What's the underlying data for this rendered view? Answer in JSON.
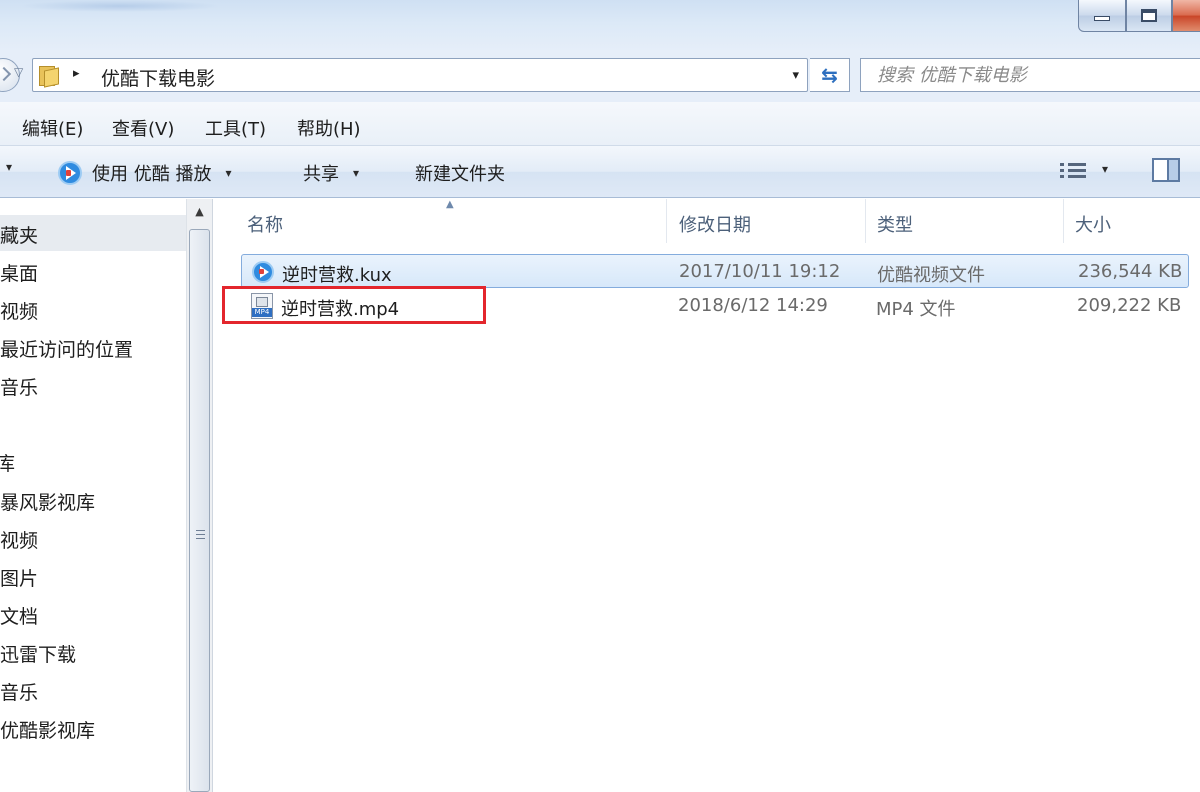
{
  "window": {
    "controls": [
      "minimize",
      "maximize",
      "close"
    ]
  },
  "address": {
    "path": "优酷下载电影",
    "separator": "▸",
    "dropdown": "▾",
    "refresh_icon": "refresh-icon"
  },
  "search": {
    "placeholder": "搜索 优酷下载电影"
  },
  "menubar": {
    "items": [
      "编辑(E)",
      "查看(V)",
      "工具(T)",
      "帮助(H)"
    ]
  },
  "toolbar": {
    "play_label": "使用 优酷 播放",
    "share_label": "共享",
    "new_folder_label": "新建文件夹",
    "caret": "▾"
  },
  "navpane": {
    "items": [
      {
        "label": "收藏夹",
        "visible_text": "藏夹"
      },
      {
        "label": "桌面"
      },
      {
        "label": "视频"
      },
      {
        "label": "最近访问的位置"
      },
      {
        "label": "音乐"
      },
      {
        "label": "库",
        "visible_text": "库"
      },
      {
        "label": "暴风影视库"
      },
      {
        "label": "视频"
      },
      {
        "label": "图片"
      },
      {
        "label": "文档"
      },
      {
        "label": "迅雷下载"
      },
      {
        "label": "音乐"
      },
      {
        "label": "优酷影视库"
      }
    ]
  },
  "filelist": {
    "columns": [
      "名称",
      "修改日期",
      "类型",
      "大小"
    ],
    "rows": [
      {
        "name": "逆时营救.kux",
        "modified": "2017/10/11 19:12",
        "type": "优酷视频文件",
        "size": "236,544 KB",
        "icon": "youku-file-icon",
        "selected": true
      },
      {
        "name": "逆时营救.mp4",
        "modified": "2018/6/12 14:29",
        "type": "MP4 文件",
        "size": "209,222 KB",
        "icon": "mp4-file-icon",
        "selected": false,
        "highlighted": true
      }
    ]
  },
  "colors": {
    "highlight": "#e3262d",
    "selection": "#d7e8fa",
    "header_text": "#4c607a"
  }
}
